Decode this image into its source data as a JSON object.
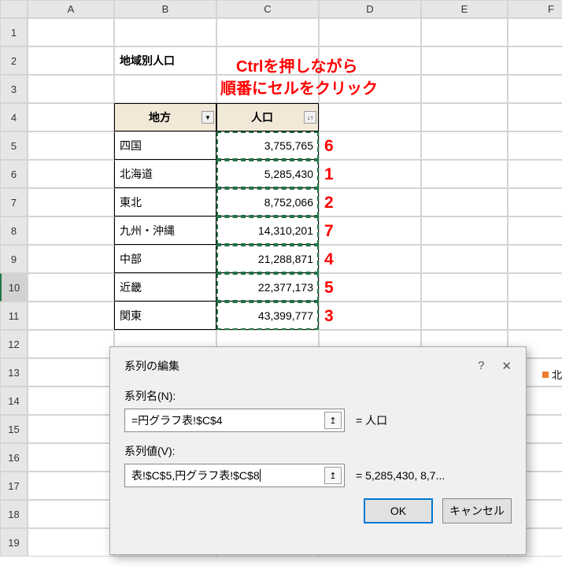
{
  "columns": [
    "A",
    "B",
    "C",
    "D",
    "E",
    "F"
  ],
  "rows": [
    "1",
    "2",
    "3",
    "4",
    "5",
    "6",
    "7",
    "8",
    "9",
    "10",
    "11",
    "12",
    "13",
    "14",
    "15",
    "16",
    "17",
    "18",
    "19"
  ],
  "title_cell": "地域別人口",
  "table": {
    "header_region": "地方",
    "header_pop": "人口",
    "rows": [
      {
        "region": "四国",
        "pop": "3,755,765",
        "order": "6"
      },
      {
        "region": "北海道",
        "pop": "5,285,430",
        "order": "1"
      },
      {
        "region": "東北",
        "pop": "8,752,066",
        "order": "2"
      },
      {
        "region": "九州・沖縄",
        "pop": "14,310,201",
        "order": "7"
      },
      {
        "region": "中部",
        "pop": "21,288,871",
        "order": "4"
      },
      {
        "region": "近畿",
        "pop": "22,377,173",
        "order": "5"
      },
      {
        "region": "関東",
        "pop": "43,399,777",
        "order": "3"
      }
    ]
  },
  "callout_line1": "Ctrlを押しながら",
  "callout_line2": "順番にセルをクリック",
  "dialog": {
    "title": "系列の編集",
    "help": "?",
    "close": "✕",
    "name_label": "系列名(N):",
    "name_value": "=円グラフ表!$C$4",
    "name_result": "= 人口",
    "values_label": "系列値(V):",
    "values_value": "表!$C$5,円グラフ表!$C$8",
    "values_result": "= 5,285,430, 8,7...",
    "ok": "OK",
    "cancel": "キャンセル"
  },
  "legend_text": "北"
}
